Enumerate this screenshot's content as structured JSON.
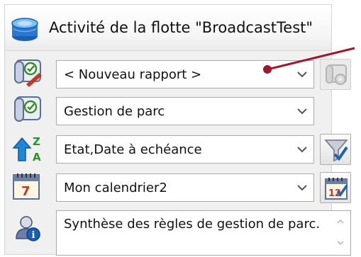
{
  "window": {
    "title": "Activité de la flotte \"BroadcastTest\"",
    "title_icon": "database-icon"
  },
  "rows": [
    {
      "icon": "report-scroll-icon",
      "value": "< Nouveau rapport >",
      "side_button_icon": "report-settings-icon",
      "side_button_enabled": false
    },
    {
      "icon": "template-scroll-icon",
      "value": "Gestion de parc"
    },
    {
      "icon": "sort-az-icon",
      "value": "Etat,Date à echéance",
      "side_button_icon": "filter-icon",
      "side_button_enabled": true
    },
    {
      "icon": "calendar-icon",
      "value": "Mon calendrier2",
      "side_button_icon": "calendar-edit-icon",
      "side_button_enabled": true
    }
  ],
  "description": {
    "icon": "info-user-icon",
    "text": "Synthèse des règles de gestion de parc."
  },
  "colors": {
    "annotation": "#a0172e",
    "select_border": "#a9a9a9",
    "panel_bg": "#f0f0f0"
  }
}
